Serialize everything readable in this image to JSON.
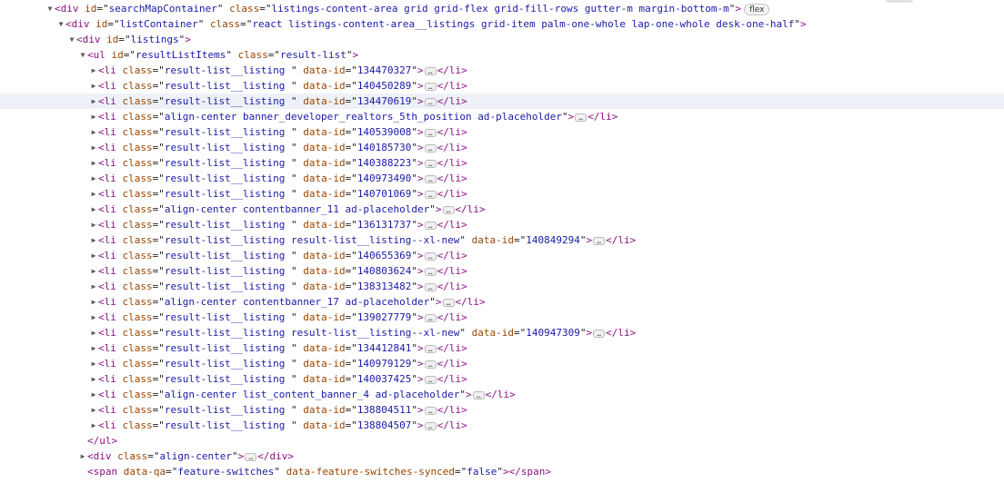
{
  "badge": "flex",
  "nodes": [
    {
      "depth": 0,
      "twisty": "open",
      "kind": "open",
      "tag": "div",
      "attrs": [
        {
          "name": "id",
          "value": "searchMapContainer"
        },
        {
          "name": "class",
          "value": "listings-content-area grid grid-flex grid-fill-rows gutter-m margin-bottom-m"
        }
      ],
      "badge": true
    },
    {
      "depth": 1,
      "twisty": "open",
      "kind": "open",
      "tag": "div",
      "attrs": [
        {
          "name": "id",
          "value": "listContainer"
        },
        {
          "name": "class",
          "value": "react listings-content-area__listings grid-item palm-one-whole lap-one-whole desk-one-half"
        }
      ]
    },
    {
      "depth": 2,
      "twisty": "open",
      "kind": "open",
      "tag": "div",
      "attrs": [
        {
          "name": "id",
          "value": "listings"
        }
      ]
    },
    {
      "depth": 3,
      "twisty": "open",
      "kind": "open",
      "tag": "ul",
      "attrs": [
        {
          "name": "id",
          "value": "resultListItems"
        },
        {
          "name": "class",
          "value": "result-list"
        }
      ]
    },
    {
      "depth": 4,
      "twisty": "closed",
      "kind": "collapsed",
      "tag": "li",
      "attrs": [
        {
          "name": "class",
          "value": "result-list__listing "
        },
        {
          "name": "data-id",
          "value": "134470327"
        }
      ]
    },
    {
      "depth": 4,
      "twisty": "closed",
      "kind": "collapsed",
      "tag": "li",
      "attrs": [
        {
          "name": "class",
          "value": "result-list__listing "
        },
        {
          "name": "data-id",
          "value": "140450289"
        }
      ]
    },
    {
      "depth": 4,
      "twisty": "closed",
      "kind": "collapsed",
      "tag": "li",
      "attrs": [
        {
          "name": "class",
          "value": "result-list__listing "
        },
        {
          "name": "data-id",
          "value": "134470619"
        }
      ],
      "selected": true
    },
    {
      "depth": 4,
      "twisty": "closed",
      "kind": "collapsed",
      "tag": "li",
      "attrs": [
        {
          "name": "class",
          "value": "align-center banner_developer_realtors_5th_position ad-placeholder"
        }
      ]
    },
    {
      "depth": 4,
      "twisty": "closed",
      "kind": "collapsed",
      "tag": "li",
      "attrs": [
        {
          "name": "class",
          "value": "result-list__listing "
        },
        {
          "name": "data-id",
          "value": "140539008"
        }
      ]
    },
    {
      "depth": 4,
      "twisty": "closed",
      "kind": "collapsed",
      "tag": "li",
      "attrs": [
        {
          "name": "class",
          "value": "result-list__listing "
        },
        {
          "name": "data-id",
          "value": "140185730"
        }
      ]
    },
    {
      "depth": 4,
      "twisty": "closed",
      "kind": "collapsed",
      "tag": "li",
      "attrs": [
        {
          "name": "class",
          "value": "result-list__listing "
        },
        {
          "name": "data-id",
          "value": "140388223"
        }
      ]
    },
    {
      "depth": 4,
      "twisty": "closed",
      "kind": "collapsed",
      "tag": "li",
      "attrs": [
        {
          "name": "class",
          "value": "result-list__listing "
        },
        {
          "name": "data-id",
          "value": "140973490"
        }
      ]
    },
    {
      "depth": 4,
      "twisty": "closed",
      "kind": "collapsed",
      "tag": "li",
      "attrs": [
        {
          "name": "class",
          "value": "result-list__listing "
        },
        {
          "name": "data-id",
          "value": "140701069"
        }
      ]
    },
    {
      "depth": 4,
      "twisty": "closed",
      "kind": "collapsed",
      "tag": "li",
      "attrs": [
        {
          "name": "class",
          "value": "align-center contentbanner_11 ad-placeholder"
        }
      ]
    },
    {
      "depth": 4,
      "twisty": "closed",
      "kind": "collapsed",
      "tag": "li",
      "attrs": [
        {
          "name": "class",
          "value": "result-list__listing "
        },
        {
          "name": "data-id",
          "value": "136131737"
        }
      ]
    },
    {
      "depth": 4,
      "twisty": "closed",
      "kind": "collapsed",
      "tag": "li",
      "attrs": [
        {
          "name": "class",
          "value": "result-list__listing result-list__listing--xl-new"
        },
        {
          "name": "data-id",
          "value": "140849294"
        }
      ]
    },
    {
      "depth": 4,
      "twisty": "closed",
      "kind": "collapsed",
      "tag": "li",
      "attrs": [
        {
          "name": "class",
          "value": "result-list__listing "
        },
        {
          "name": "data-id",
          "value": "140655369"
        }
      ]
    },
    {
      "depth": 4,
      "twisty": "closed",
      "kind": "collapsed",
      "tag": "li",
      "attrs": [
        {
          "name": "class",
          "value": "result-list__listing "
        },
        {
          "name": "data-id",
          "value": "140803624"
        }
      ]
    },
    {
      "depth": 4,
      "twisty": "closed",
      "kind": "collapsed",
      "tag": "li",
      "attrs": [
        {
          "name": "class",
          "value": "result-list__listing "
        },
        {
          "name": "data-id",
          "value": "138313482"
        }
      ]
    },
    {
      "depth": 4,
      "twisty": "closed",
      "kind": "collapsed",
      "tag": "li",
      "attrs": [
        {
          "name": "class",
          "value": "align-center contentbanner_17 ad-placeholder"
        }
      ]
    },
    {
      "depth": 4,
      "twisty": "closed",
      "kind": "collapsed",
      "tag": "li",
      "attrs": [
        {
          "name": "class",
          "value": "result-list__listing "
        },
        {
          "name": "data-id",
          "value": "139027779"
        }
      ]
    },
    {
      "depth": 4,
      "twisty": "closed",
      "kind": "collapsed",
      "tag": "li",
      "attrs": [
        {
          "name": "class",
          "value": "result-list__listing result-list__listing--xl-new"
        },
        {
          "name": "data-id",
          "value": "140947309"
        }
      ]
    },
    {
      "depth": 4,
      "twisty": "closed",
      "kind": "collapsed",
      "tag": "li",
      "attrs": [
        {
          "name": "class",
          "value": "result-list__listing "
        },
        {
          "name": "data-id",
          "value": "134412841"
        }
      ]
    },
    {
      "depth": 4,
      "twisty": "closed",
      "kind": "collapsed",
      "tag": "li",
      "attrs": [
        {
          "name": "class",
          "value": "result-list__listing "
        },
        {
          "name": "data-id",
          "value": "140979129"
        }
      ]
    },
    {
      "depth": 4,
      "twisty": "closed",
      "kind": "collapsed",
      "tag": "li",
      "attrs": [
        {
          "name": "class",
          "value": "result-list__listing "
        },
        {
          "name": "data-id",
          "value": "140037425"
        }
      ]
    },
    {
      "depth": 4,
      "twisty": "closed",
      "kind": "collapsed",
      "tag": "li",
      "attrs": [
        {
          "name": "class",
          "value": "align-center list_content_banner_4 ad-placeholder"
        }
      ]
    },
    {
      "depth": 4,
      "twisty": "closed",
      "kind": "collapsed",
      "tag": "li",
      "attrs": [
        {
          "name": "class",
          "value": "result-list__listing "
        },
        {
          "name": "data-id",
          "value": "138804511"
        }
      ]
    },
    {
      "depth": 4,
      "twisty": "closed",
      "kind": "collapsed",
      "tag": "li",
      "attrs": [
        {
          "name": "class",
          "value": "result-list__listing "
        },
        {
          "name": "data-id",
          "value": "138804507"
        }
      ]
    },
    {
      "depth": 3,
      "twisty": "none",
      "kind": "close",
      "tag": "ul"
    },
    {
      "depth": 3,
      "twisty": "closed",
      "kind": "collapsed",
      "tag": "div",
      "attrs": [
        {
          "name": "class",
          "value": "align-center"
        }
      ]
    },
    {
      "depth": 3,
      "twisty": "none",
      "kind": "full",
      "tag": "span",
      "attrs": [
        {
          "name": "data-qa",
          "value": "feature-switches"
        },
        {
          "name": "data-feature-switches-synced",
          "value": "false"
        }
      ]
    }
  ]
}
